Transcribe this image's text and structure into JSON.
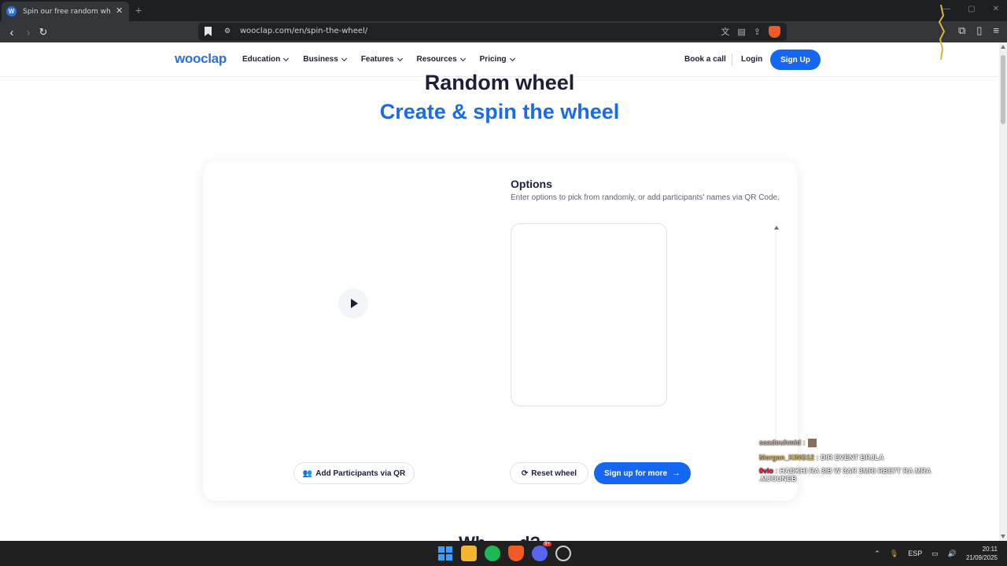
{
  "browser": {
    "tab_title": "Spin our free random wheel for ...",
    "tab_favicon_letter": "W",
    "tab_close": "✕",
    "new_tab": "+",
    "url": "wooclap.com/en/spin-the-wheel/",
    "window_controls": [
      "—",
      "▢",
      "✕"
    ]
  },
  "site": {
    "logo": "wooclap",
    "menu": [
      {
        "label": "Education"
      },
      {
        "label": "Business"
      },
      {
        "label": "Features"
      },
      {
        "label": "Resources"
      },
      {
        "label": "Pricing"
      }
    ],
    "book_call": "Book a call",
    "login": "Login",
    "signup": "Sign Up"
  },
  "hero": {
    "title": "Random wheel",
    "subtitle": "Create & spin the wheel"
  },
  "wheel_card": {
    "options_title": "Options",
    "options_desc": "Enter options to pick from randomly, or add participants' names via QR Code.",
    "add_participants": "Add Participants via QR",
    "reset_wheel": "Reset wheel",
    "sign_up_more": "Sign up for more"
  },
  "bottom_heading": "Wh... ...d?",
  "chat": [
    {
      "name": "saadouhmid",
      "sep": " :",
      "msg": ""
    },
    {
      "name": "Morgan_KING12",
      "sep": " : ",
      "msg": "DIR EVENT BRJLA"
    },
    {
      "name": "0vlo",
      "sep": " : ",
      "msg": "HADKHI RA 3IB W 3AR 3MRI RBE7T RA MRA .MJOUNEB"
    }
  ],
  "taskbar": {
    "lang": "ESP",
    "time": "20:11",
    "date": "21/09/2025",
    "badge": "9+"
  },
  "colors": {
    "brand_blue": "#1566f0",
    "logo_blue": "#2b6fe0",
    "heading_navy": "#1b1f3b",
    "subtitle_blue": "#1a6be8"
  }
}
